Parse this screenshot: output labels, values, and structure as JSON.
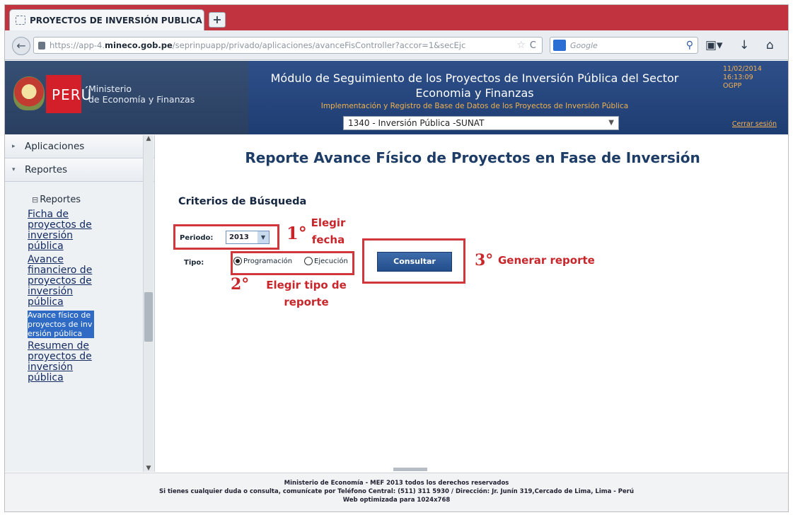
{
  "browser": {
    "tab_title": "PROYECTOS DE INVERSIÓN PUBLICA",
    "new_tab": "+",
    "url_prefix": "https://app-4.",
    "url_domain": "mineco.gob.pe",
    "url_rest": "/seprinpuapp/privado/aplicaciones/avanceFisController?accor=1&secEjc",
    "search_placeholder": "Google"
  },
  "header": {
    "brand_country": "PERÚ",
    "ministry_line1": "Ministerio",
    "ministry_line2": "de Economía y Finanzas",
    "title_line1": "Módulo de Seguimiento de los Proyectos de Inversión Pública del Sector",
    "title_line2": "Economia y Finanzas",
    "subtitle": "Implementación y Registro de Base de Datos de los Proyectos de Inversión Pública",
    "unit_selected": "1340 - Inversión Pública -SUNAT",
    "date": "11/02/2014",
    "time": "16:13:09",
    "office": "OGPP",
    "logout": "Cerrar sesión"
  },
  "sidebar": {
    "sections": [
      {
        "label": "Aplicaciones"
      },
      {
        "label": "Reportes"
      }
    ],
    "subtree_title": "Reportes",
    "links": [
      {
        "label": "Ficha de proyectos de inversión pública"
      },
      {
        "label": "Avance financiero de proyectos de inversión pública"
      },
      {
        "label": "Avance físico de proyectos de inversión pública"
      },
      {
        "label": "Resumen de proyectos de inversión pública"
      }
    ]
  },
  "main": {
    "page_title": "Reporte Avance Físico de Proyectos en Fase de Inversión",
    "criteria_heading": "Criterios de Búsqueda",
    "periodo_label": "Periodo:",
    "periodo_value": "2013",
    "tipo_label": "Tipo:",
    "radio_programacion": "Programación",
    "radio_ejecucion": "Ejecución",
    "button_consultar": "Consultar"
  },
  "annotations": {
    "step1_num": "1°",
    "step1_text": "Elegir fecha",
    "step2_num": "2°",
    "step2_text": "Elegir tipo de reporte",
    "step3_num": "3°",
    "step3_text": "Generar reporte"
  },
  "footer": {
    "line1": "Ministerio de Economía - MEF 2013 todos los derechos reservados",
    "line2": "Si tienes cualquier duda o consulta, comunícate por Teléfono Central: (511) 311 5930 / Dirección: Jr. Junín 319,Cercado de Lima, Lima - Perú",
    "line3": "Web optimizada para 1024x768"
  },
  "colors": {
    "tabstrip": "#c0333f",
    "header_blue": "#1e3d72",
    "annotation_red": "#c8262b",
    "active_link": "#2f6bc4"
  }
}
